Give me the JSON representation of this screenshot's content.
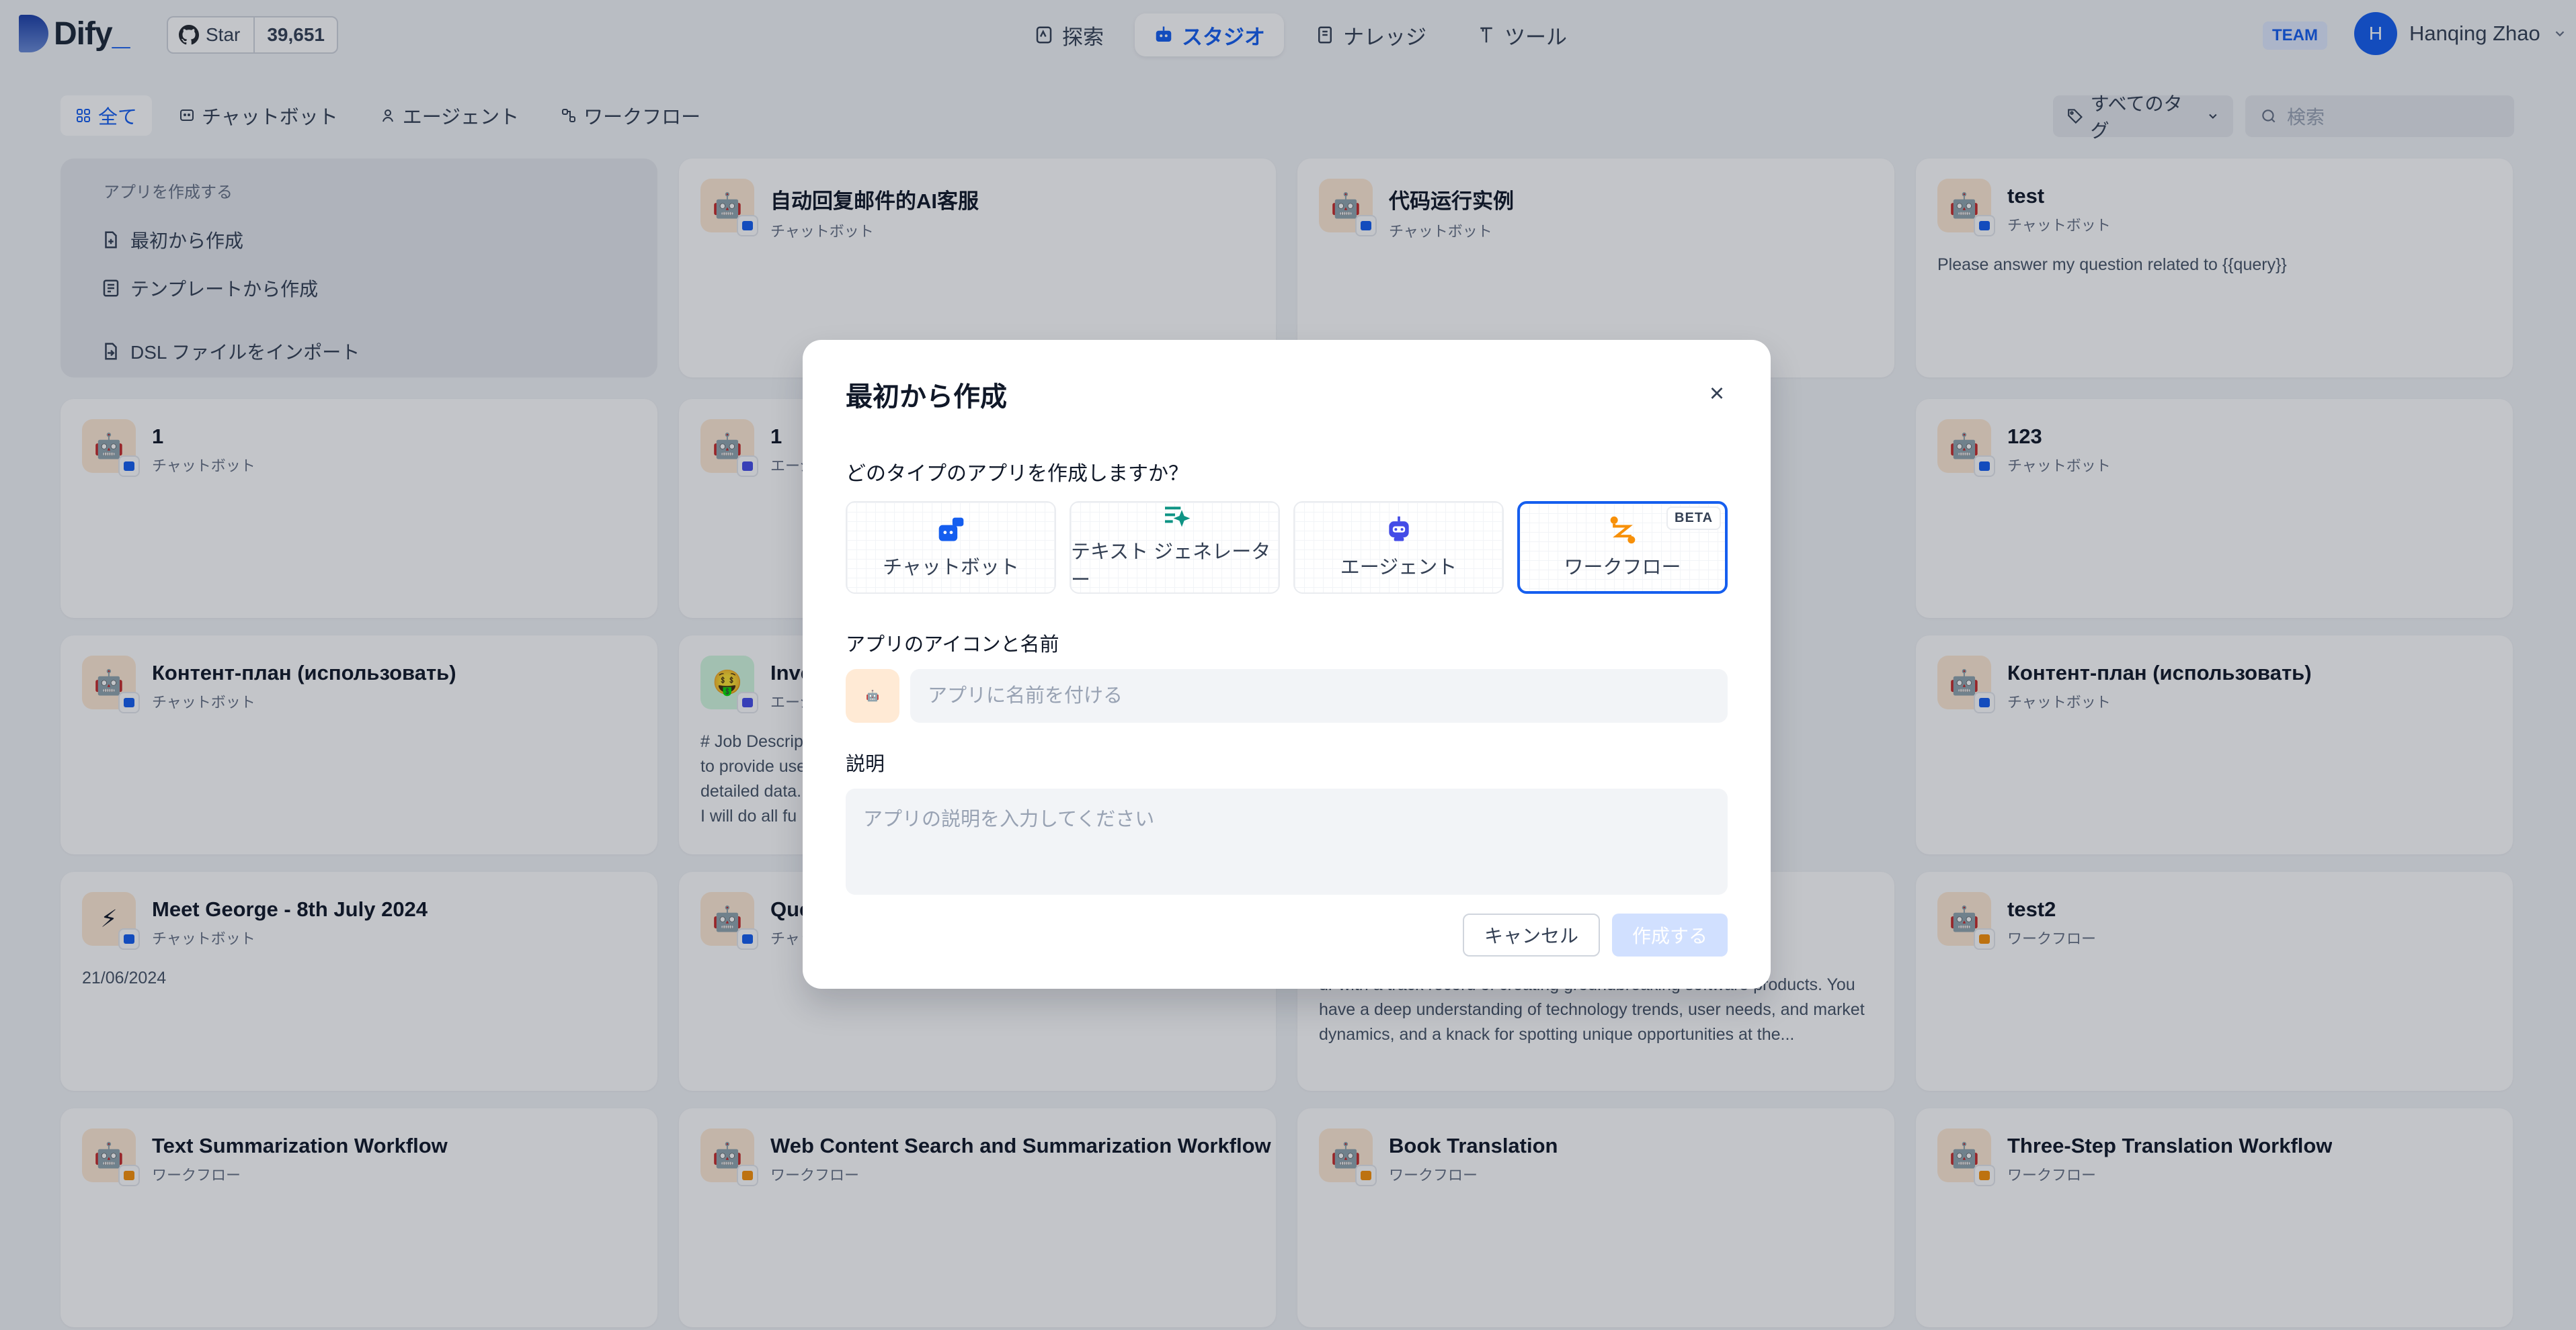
{
  "header": {
    "logo_text": "Dify",
    "github_star": "Star",
    "github_count": "39,651",
    "nav": [
      {
        "label": "探索",
        "icon": "compass-icon"
      },
      {
        "label": "スタジオ",
        "icon": "robot-icon",
        "active": true
      },
      {
        "label": "ナレッジ",
        "icon": "book-icon"
      },
      {
        "label": "ツール",
        "icon": "tool-icon"
      }
    ],
    "team_badge": "TEAM",
    "user_initial": "H",
    "user_name": "Hanqing Zhao"
  },
  "filters": {
    "tabs": [
      {
        "label": "全て",
        "active": true
      },
      {
        "label": "チャットボット"
      },
      {
        "label": "エージェント"
      },
      {
        "label": "ワークフロー"
      }
    ],
    "tag_select": "すべてのタグ",
    "search_placeholder": "検索"
  },
  "create_card": {
    "heading": "アプリを作成する",
    "from_scratch": "最初から作成",
    "from_template": "テンプレートから作成",
    "import_dsl": "DSL ファイルをインポート"
  },
  "apps": [
    {
      "name": "自动回复邮件的AI客服",
      "type": "チャットボット",
      "desc": ""
    },
    {
      "name": "代码运行实例",
      "type": "チャットボット",
      "desc": ""
    },
    {
      "name": "test",
      "type": "チャットボット",
      "desc": "Please answer my question related to {{query}}"
    },
    {
      "name": "1",
      "type": "チャットボット",
      "desc": ""
    },
    {
      "name": "1",
      "type": "エージェント",
      "desc": ""
    },
    {
      "name": "123",
      "type": "チャットボット",
      "desc": ""
    },
    {
      "name": "Контент-план (использовать)",
      "type": "チャットボット",
      "desc": ""
    },
    {
      "name": "Inve",
      "type": "エージェント",
      "desc": "# Job Descrip\nto provide use\ndetailed data.\nI will do all fu"
    },
    {
      "name": "Контент-план (использовать)",
      "type": "チャットボット",
      "desc": ""
    },
    {
      "name": "Meet George - 8th July 2024",
      "type": "チャットボット",
      "desc": "21/06/2024"
    },
    {
      "name": "Que",
      "type": "チャットボット",
      "desc": ""
    },
    {
      "name": "",
      "type": "",
      "desc": "ur with a track record of creating groundbreaking software products. You have a deep understanding of technology trends, user needs, and market dynamics, and a knack for spotting unique opportunities at the..."
    },
    {
      "name": "test2",
      "type": "ワークフロー",
      "desc": ""
    },
    {
      "name": "Text Summarization Workflow",
      "type": "ワークフロー",
      "desc": ""
    },
    {
      "name": "Web Content Search and Summarization Workflow",
      "type": "ワークフロー",
      "desc": ""
    },
    {
      "name": "Book Translation",
      "type": "ワークフロー",
      "desc": ""
    },
    {
      "name": "Three-Step Translation Workflow",
      "type": "ワークフロー",
      "desc": ""
    }
  ],
  "modal": {
    "title": "最初から作成",
    "question": "どのタイプのアプリを作成しますか？",
    "types": [
      {
        "label": "チャットボット",
        "icon": "chatbot-icon"
      },
      {
        "label": "テキスト ジェネレーター",
        "icon": "text-generator-icon"
      },
      {
        "label": "エージェント",
        "icon": "agent-icon"
      },
      {
        "label": "ワークフロー",
        "icon": "workflow-icon",
        "selected": true,
        "badge": "BETA"
      }
    ],
    "name_label": "アプリのアイコンと名前",
    "name_placeholder": "アプリに名前を付ける",
    "desc_label": "説明",
    "desc_placeholder": "アプリの説明を入力してください",
    "cancel": "キャンセル",
    "create": "作成する"
  },
  "colors": {
    "accent": "#155eef",
    "workflow": "#f79009",
    "text_gen": "#0e9384"
  }
}
